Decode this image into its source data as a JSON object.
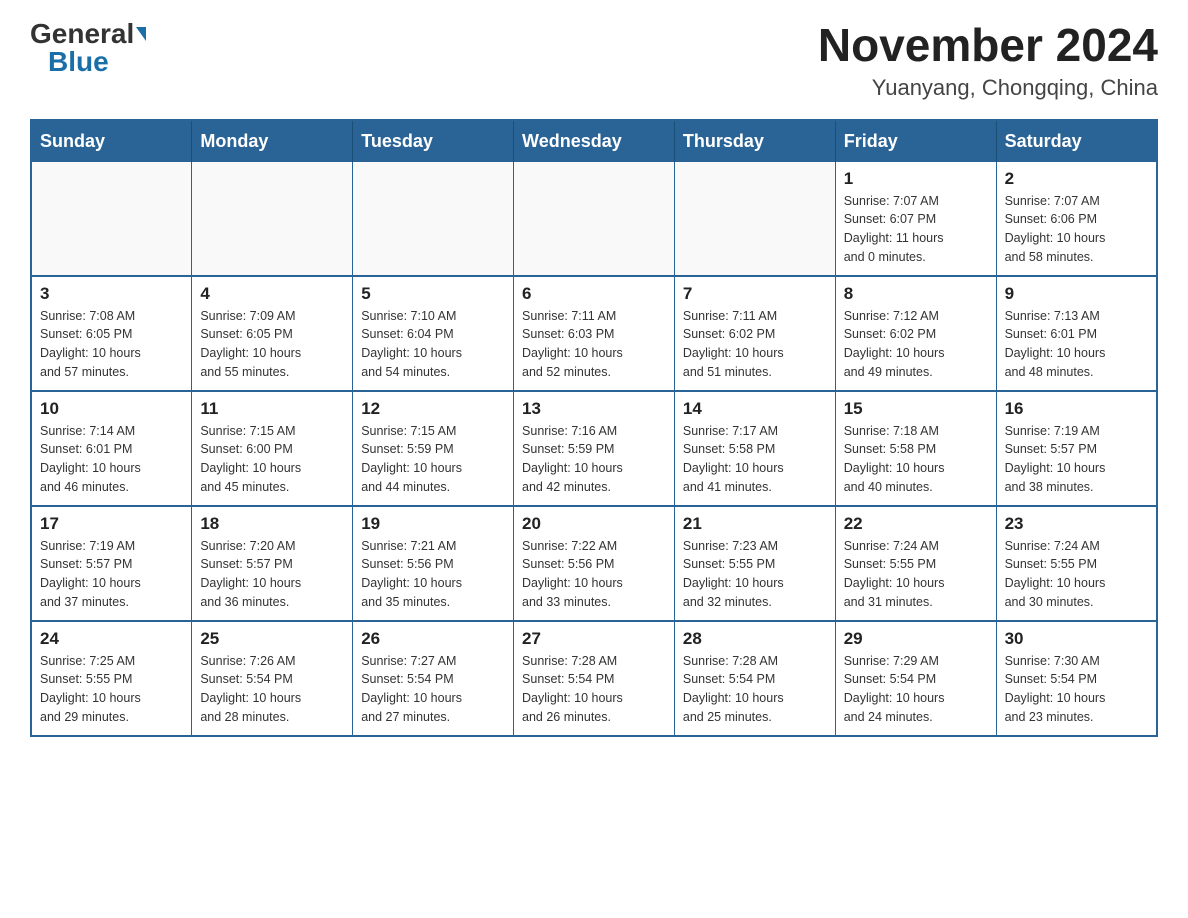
{
  "header": {
    "logo_general": "General",
    "logo_blue": "Blue",
    "month_title": "November 2024",
    "location": "Yuanyang, Chongqing, China"
  },
  "days_of_week": [
    "Sunday",
    "Monday",
    "Tuesday",
    "Wednesday",
    "Thursday",
    "Friday",
    "Saturday"
  ],
  "weeks": [
    [
      {
        "day": "",
        "info": ""
      },
      {
        "day": "",
        "info": ""
      },
      {
        "day": "",
        "info": ""
      },
      {
        "day": "",
        "info": ""
      },
      {
        "day": "",
        "info": ""
      },
      {
        "day": "1",
        "info": "Sunrise: 7:07 AM\nSunset: 6:07 PM\nDaylight: 11 hours\nand 0 minutes."
      },
      {
        "day": "2",
        "info": "Sunrise: 7:07 AM\nSunset: 6:06 PM\nDaylight: 10 hours\nand 58 minutes."
      }
    ],
    [
      {
        "day": "3",
        "info": "Sunrise: 7:08 AM\nSunset: 6:05 PM\nDaylight: 10 hours\nand 57 minutes."
      },
      {
        "day": "4",
        "info": "Sunrise: 7:09 AM\nSunset: 6:05 PM\nDaylight: 10 hours\nand 55 minutes."
      },
      {
        "day": "5",
        "info": "Sunrise: 7:10 AM\nSunset: 6:04 PM\nDaylight: 10 hours\nand 54 minutes."
      },
      {
        "day": "6",
        "info": "Sunrise: 7:11 AM\nSunset: 6:03 PM\nDaylight: 10 hours\nand 52 minutes."
      },
      {
        "day": "7",
        "info": "Sunrise: 7:11 AM\nSunset: 6:02 PM\nDaylight: 10 hours\nand 51 minutes."
      },
      {
        "day": "8",
        "info": "Sunrise: 7:12 AM\nSunset: 6:02 PM\nDaylight: 10 hours\nand 49 minutes."
      },
      {
        "day": "9",
        "info": "Sunrise: 7:13 AM\nSunset: 6:01 PM\nDaylight: 10 hours\nand 48 minutes."
      }
    ],
    [
      {
        "day": "10",
        "info": "Sunrise: 7:14 AM\nSunset: 6:01 PM\nDaylight: 10 hours\nand 46 minutes."
      },
      {
        "day": "11",
        "info": "Sunrise: 7:15 AM\nSunset: 6:00 PM\nDaylight: 10 hours\nand 45 minutes."
      },
      {
        "day": "12",
        "info": "Sunrise: 7:15 AM\nSunset: 5:59 PM\nDaylight: 10 hours\nand 44 minutes."
      },
      {
        "day": "13",
        "info": "Sunrise: 7:16 AM\nSunset: 5:59 PM\nDaylight: 10 hours\nand 42 minutes."
      },
      {
        "day": "14",
        "info": "Sunrise: 7:17 AM\nSunset: 5:58 PM\nDaylight: 10 hours\nand 41 minutes."
      },
      {
        "day": "15",
        "info": "Sunrise: 7:18 AM\nSunset: 5:58 PM\nDaylight: 10 hours\nand 40 minutes."
      },
      {
        "day": "16",
        "info": "Sunrise: 7:19 AM\nSunset: 5:57 PM\nDaylight: 10 hours\nand 38 minutes."
      }
    ],
    [
      {
        "day": "17",
        "info": "Sunrise: 7:19 AM\nSunset: 5:57 PM\nDaylight: 10 hours\nand 37 minutes."
      },
      {
        "day": "18",
        "info": "Sunrise: 7:20 AM\nSunset: 5:57 PM\nDaylight: 10 hours\nand 36 minutes."
      },
      {
        "day": "19",
        "info": "Sunrise: 7:21 AM\nSunset: 5:56 PM\nDaylight: 10 hours\nand 35 minutes."
      },
      {
        "day": "20",
        "info": "Sunrise: 7:22 AM\nSunset: 5:56 PM\nDaylight: 10 hours\nand 33 minutes."
      },
      {
        "day": "21",
        "info": "Sunrise: 7:23 AM\nSunset: 5:55 PM\nDaylight: 10 hours\nand 32 minutes."
      },
      {
        "day": "22",
        "info": "Sunrise: 7:24 AM\nSunset: 5:55 PM\nDaylight: 10 hours\nand 31 minutes."
      },
      {
        "day": "23",
        "info": "Sunrise: 7:24 AM\nSunset: 5:55 PM\nDaylight: 10 hours\nand 30 minutes."
      }
    ],
    [
      {
        "day": "24",
        "info": "Sunrise: 7:25 AM\nSunset: 5:55 PM\nDaylight: 10 hours\nand 29 minutes."
      },
      {
        "day": "25",
        "info": "Sunrise: 7:26 AM\nSunset: 5:54 PM\nDaylight: 10 hours\nand 28 minutes."
      },
      {
        "day": "26",
        "info": "Sunrise: 7:27 AM\nSunset: 5:54 PM\nDaylight: 10 hours\nand 27 minutes."
      },
      {
        "day": "27",
        "info": "Sunrise: 7:28 AM\nSunset: 5:54 PM\nDaylight: 10 hours\nand 26 minutes."
      },
      {
        "day": "28",
        "info": "Sunrise: 7:28 AM\nSunset: 5:54 PM\nDaylight: 10 hours\nand 25 minutes."
      },
      {
        "day": "29",
        "info": "Sunrise: 7:29 AM\nSunset: 5:54 PM\nDaylight: 10 hours\nand 24 minutes."
      },
      {
        "day": "30",
        "info": "Sunrise: 7:30 AM\nSunset: 5:54 PM\nDaylight: 10 hours\nand 23 minutes."
      }
    ]
  ]
}
